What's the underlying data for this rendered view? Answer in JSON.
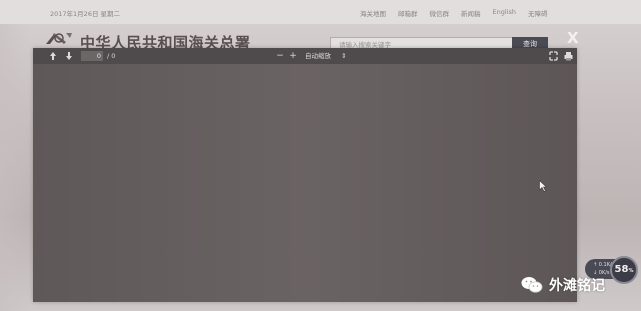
{
  "top_bar": {
    "date": "2017年1月26日 星期二",
    "links": [
      "海关地图",
      "邮箱群",
      "微信群",
      "新闻稿",
      "English",
      "无障碍"
    ]
  },
  "header": {
    "site_title": "中华人民共和国海关总署",
    "search_placeholder": "请输入搜索关键字",
    "search_button": "查询",
    "close_label": "X"
  },
  "pdf_viewer": {
    "page_current": "0",
    "page_total": "/ 0",
    "zoom_out": "−",
    "zoom_in": "+",
    "zoom_mode": "自动缩放",
    "zoom_caret": "⇕"
  },
  "widgets": {
    "net_speed_up": "↑ 0.1K/s",
    "net_speed_down": "↓ 0K/s",
    "battery_percent": "58",
    "battery_unit": "%",
    "wechat_account": "外滩铭记"
  },
  "colors": {
    "viewer_bg": "#635d5e",
    "toolbar_bg": "#4f4a4b",
    "search_button_bg": "#4a4a55"
  }
}
